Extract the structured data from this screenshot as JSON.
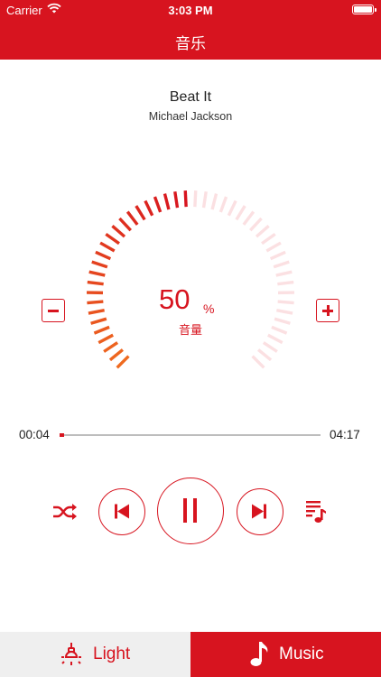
{
  "status_bar": {
    "carrier": "Carrier",
    "time": "3:03 PM"
  },
  "header": {
    "title": "音乐"
  },
  "now_playing": {
    "title": "Beat It",
    "artist": "Michael Jackson"
  },
  "volume": {
    "value": "50",
    "unit": "%",
    "label": "音量",
    "level": 0.5
  },
  "progress": {
    "current": "00:04",
    "total": "04:17",
    "fraction": 0.016
  },
  "tabs": [
    {
      "label": "Light",
      "icon": "bulb-icon",
      "active": false
    },
    {
      "label": "Music",
      "icon": "music-note-icon",
      "active": true
    }
  ],
  "colors": {
    "accent": "#d7141f",
    "orange": "#ef6a1f",
    "inactive_tick": "#fbe0e2",
    "tab_inactive_bg": "#efefef"
  }
}
